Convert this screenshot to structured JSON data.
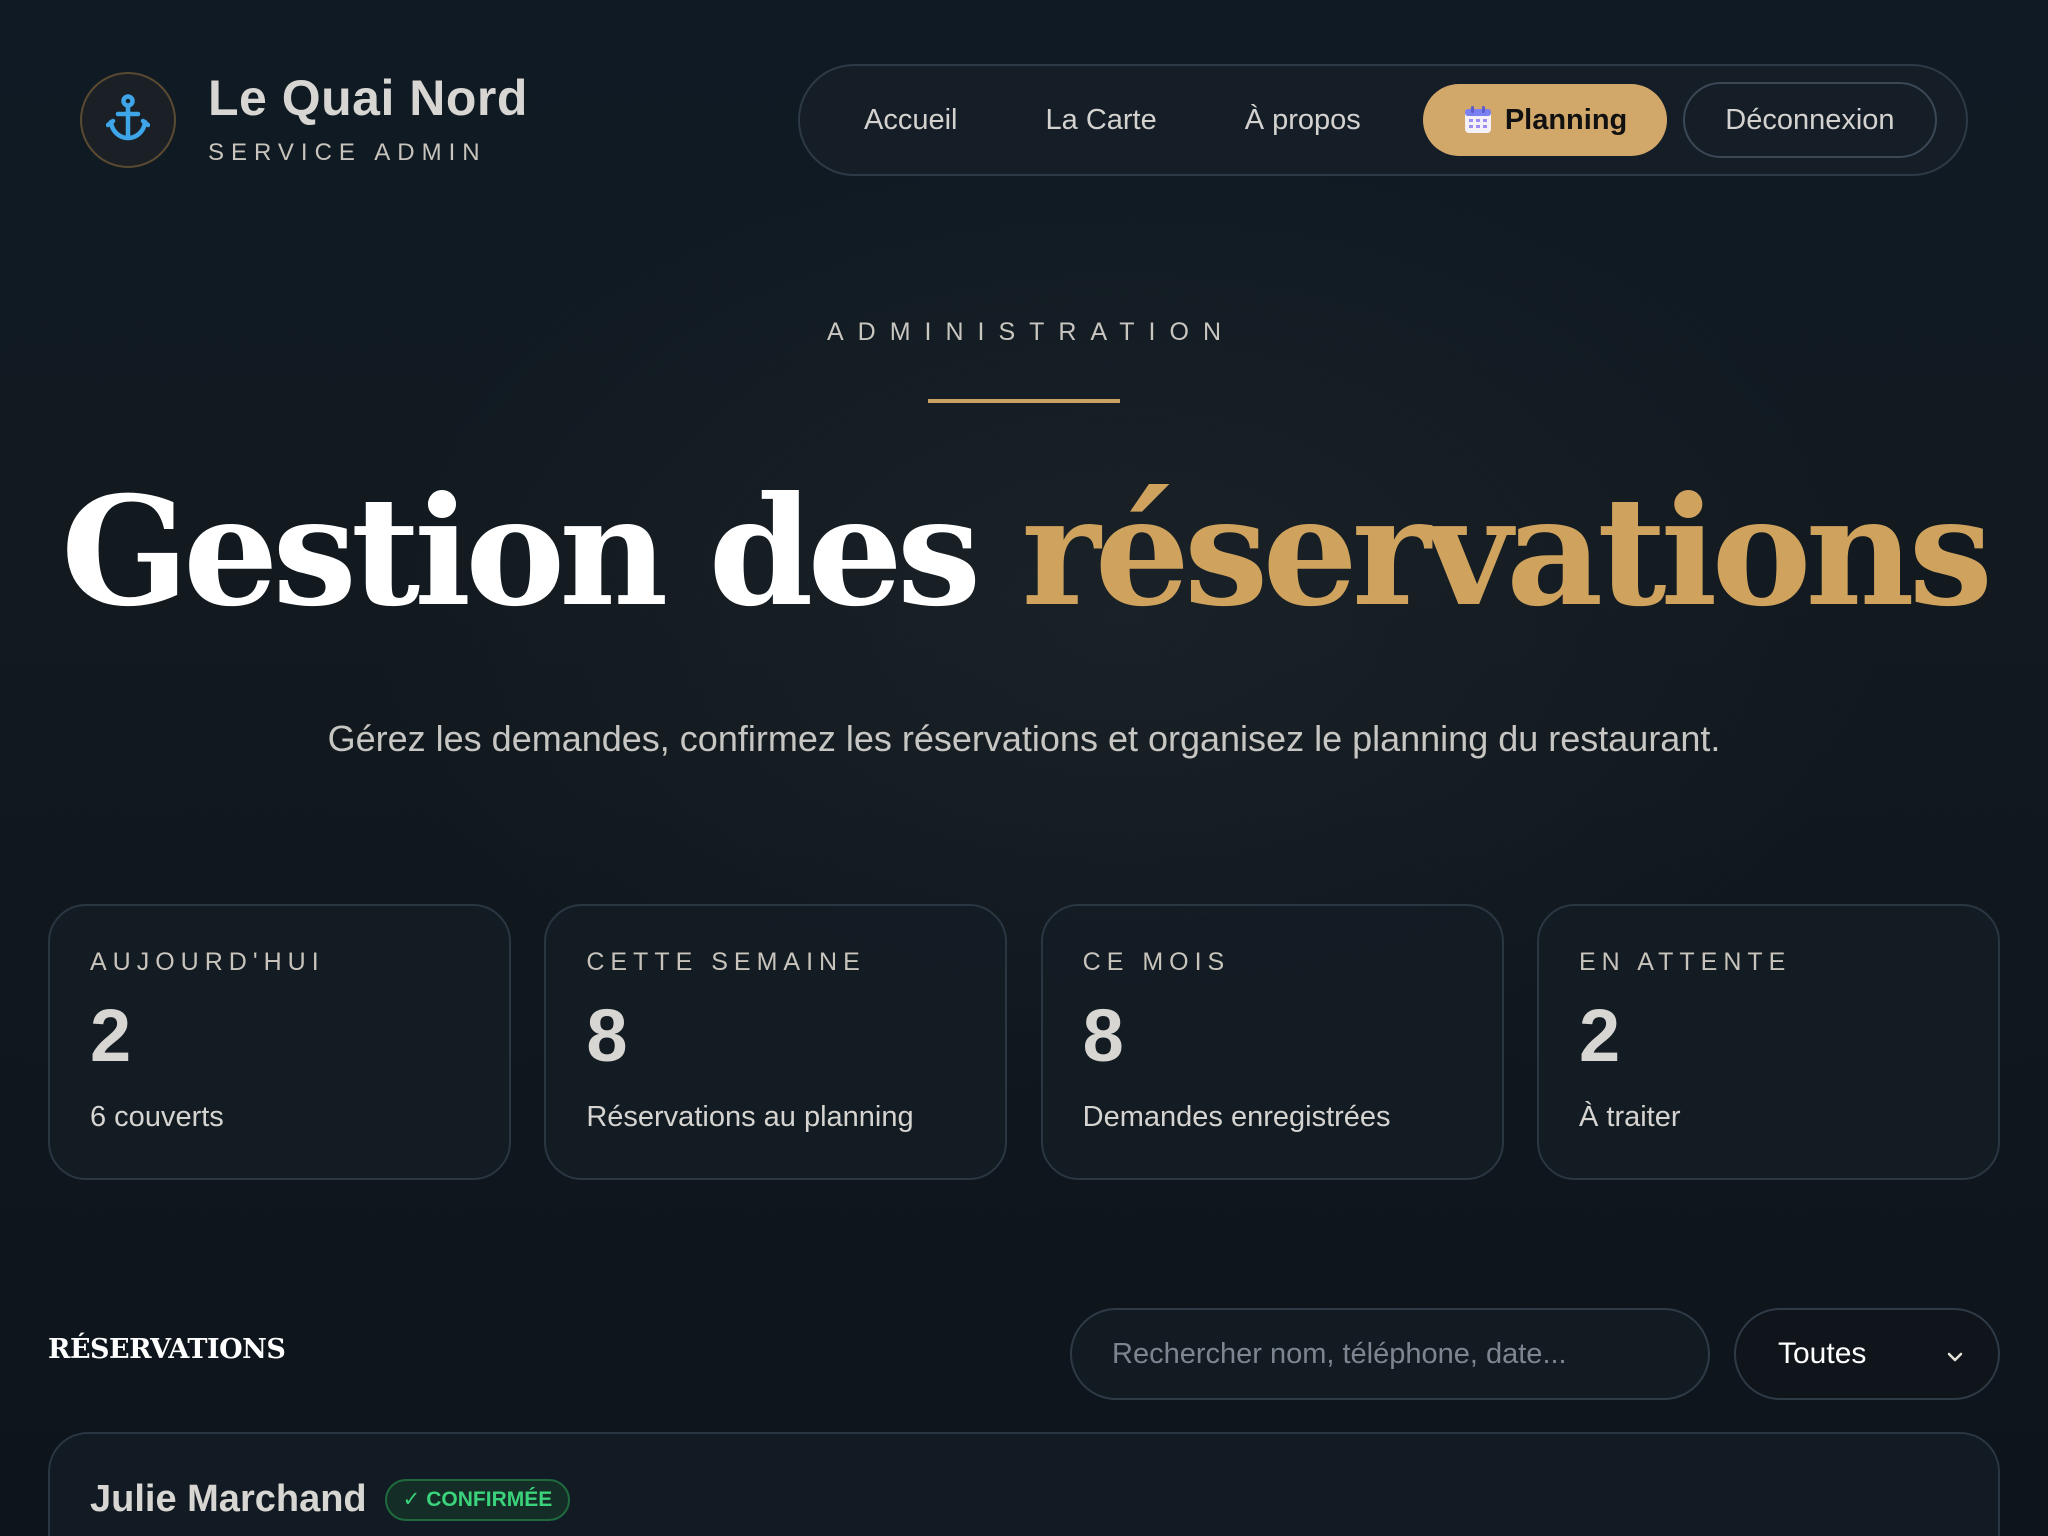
{
  "brand": {
    "name": "Le Quai Nord",
    "subtitle": "SERVICE ADMIN",
    "logo_icon": "anchor-icon",
    "colors": {
      "icon": "#3ea6e8",
      "accent": "#d2a86a"
    }
  },
  "nav": {
    "items": [
      {
        "label": "Accueil"
      },
      {
        "label": "La Carte"
      },
      {
        "label": "À propos"
      }
    ],
    "active": {
      "label": "Planning",
      "icon": "calendar-icon"
    },
    "logout": {
      "label": "Déconnexion"
    }
  },
  "hero": {
    "eyebrow": "ADMINISTRATION",
    "title_main": "Gestion des ",
    "title_accent": "réservations",
    "subtitle": "Gérez les demandes, confirmez les réservations et organisez le planning du restaurant."
  },
  "stats": [
    {
      "label": "AUJOURD'HUI",
      "value": "2",
      "desc": "6 couverts"
    },
    {
      "label": "CETTE SEMAINE",
      "value": "8",
      "desc": "Réservations au planning"
    },
    {
      "label": "CE MOIS",
      "value": "8",
      "desc": "Demandes enregistrées"
    },
    {
      "label": "EN ATTENTE",
      "value": "2",
      "desc": "À traiter"
    }
  ],
  "reservations": {
    "heading": "RÉSERVATIONS",
    "search_placeholder": "Rechercher nom, téléphone, date...",
    "filter_value": "Toutes",
    "items": [
      {
        "name": "Julie Marchand",
        "status": "CONFIRMÉE",
        "status_icon": "check-icon",
        "status_color": "#3ad27a"
      }
    ]
  }
}
